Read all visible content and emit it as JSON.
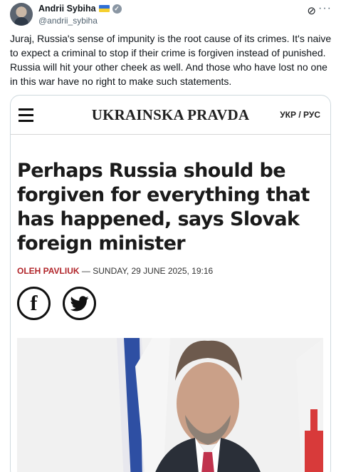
{
  "tweet": {
    "author_name": "Andrii Sybiha",
    "handle": "@andrii_sybiha",
    "text": "Juraj, Russia's sense of impunity is the root cause of its crimes. It's naive to expect a criminal to stop if their crime is forgiven instead of punished. Russia will hit your other cheek as well. And those who have lost no one in this war have no right to make such statements.",
    "icons": {
      "avatar": "avatar",
      "flag": "ukraine-flag-icon",
      "verified": "verified-badge-icon",
      "grok": "grok-icon",
      "more": "more-icon"
    }
  },
  "article": {
    "site_name": "UKRAINSKA PRAVDA",
    "language_switch": "УКР / РУС",
    "headline": "Perhaps Russia should be forgiven for everything that has happened, says Slovak foreign minister",
    "author": "OLEH PAVLIUK",
    "date": " — SUNDAY, 29 JUNE 2025, 19:16",
    "share": {
      "facebook": "facebook-icon",
      "twitter": "twitter-icon"
    }
  },
  "colors": {
    "accent_red": "#b1252a",
    "flag_blue": "#2f6fd6",
    "flag_yellow": "#f5cf2e",
    "border": "#cfd9de"
  }
}
